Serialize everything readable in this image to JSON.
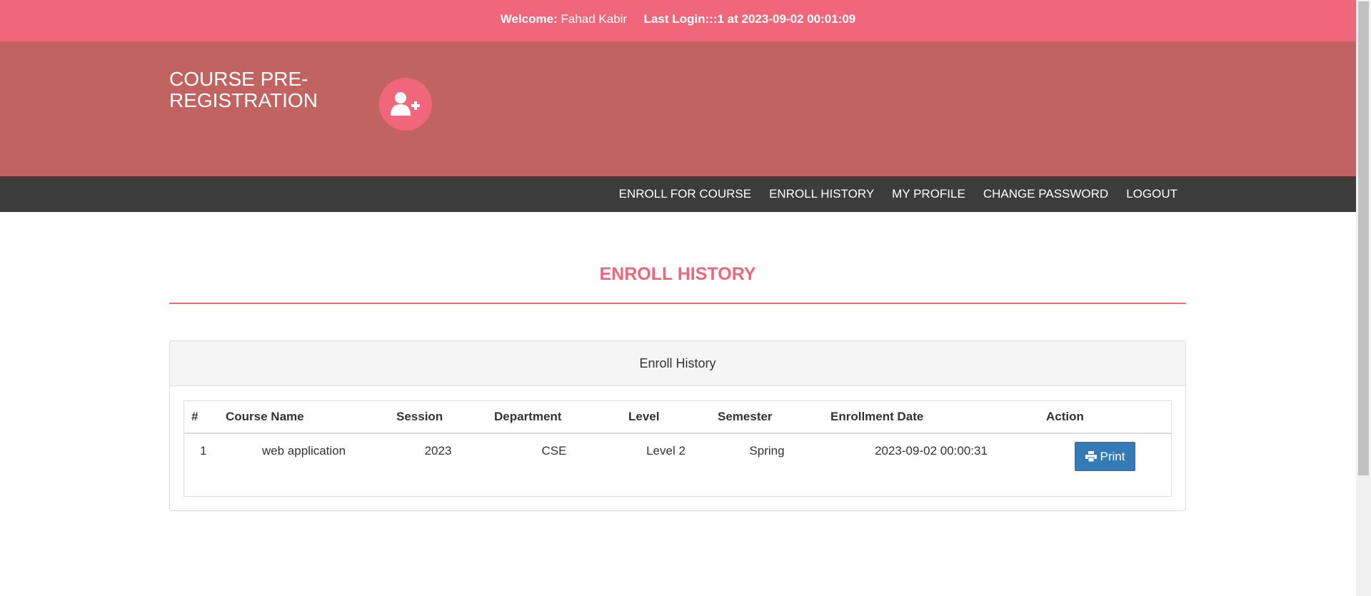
{
  "topbar": {
    "welcome_label": "Welcome:",
    "user_name": "Fahad Kabir",
    "last_login": "Last Login:::1 at 2023-09-02 00:01:09"
  },
  "brand": {
    "title": "COURSE PRE-REGISTRATION",
    "icon": "user-plus-icon"
  },
  "nav": {
    "items": [
      {
        "label": "ENROLL FOR COURSE"
      },
      {
        "label": "ENROLL HISTORY"
      },
      {
        "label": "MY PROFILE"
      },
      {
        "label": "CHANGE PASSWORD"
      },
      {
        "label": "LOGOUT"
      }
    ]
  },
  "page": {
    "title": "ENROLL HISTORY"
  },
  "panel": {
    "heading": "Enroll History",
    "columns": [
      "#",
      "Course Name",
      "Session",
      "Department",
      "Level",
      "Semester",
      "Enrollment Date",
      "Action"
    ],
    "rows": [
      {
        "num": "1",
        "course_name": "web application",
        "session": "2023",
        "department": "CSE",
        "level": "Level 2",
        "semester": "Spring",
        "enrollment_date": "2023-09-02 00:00:31",
        "action_label": "Print"
      }
    ]
  },
  "colors": {
    "accent": "#f0667a",
    "header": "#c16461",
    "navbar": "#3c3c3c",
    "button": "#337ab7"
  }
}
